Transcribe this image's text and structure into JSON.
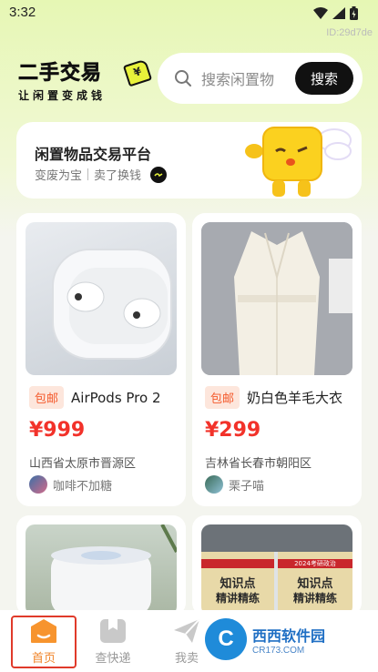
{
  "status_bar": {
    "time": "3:32",
    "device_id": "ID:29d7de"
  },
  "header": {
    "logo_title": "二手交易",
    "logo_subtitle": "让闲置变成钱",
    "search_placeholder": "搜索闲置物",
    "search_button": "搜索"
  },
  "banner": {
    "title": "闲置物品交易平台",
    "sub_left": "变废为宝",
    "sub_right": "卖了换钱"
  },
  "products": [
    {
      "badge": "包邮",
      "title": "AirPods Pro 2",
      "price": "¥999",
      "location": "山西省太原市晋源区",
      "seller": "咖啡不加糖"
    },
    {
      "badge": "包邮",
      "title": "奶白色羊毛大衣",
      "price": "¥299",
      "location": "吉林省长春市朝阳区",
      "seller": "栗子喵"
    },
    {
      "image_text_1": "知识点",
      "image_text_2": "精讲精练"
    },
    {
      "image_text_1": "2024考研政治",
      "image_text_2": "知识点",
      "image_text_3": "精讲精练"
    }
  ],
  "tabbar": {
    "items": [
      {
        "label": "首页"
      },
      {
        "label": "查快递"
      },
      {
        "label": "我卖"
      }
    ]
  },
  "watermark": {
    "brand": "西西软件园",
    "url": "CR173.COM"
  },
  "colors": {
    "accent": "#f0852a",
    "price": "#f2322a",
    "badge_bg": "#fde6dc",
    "badge_text": "#f45a2c"
  }
}
